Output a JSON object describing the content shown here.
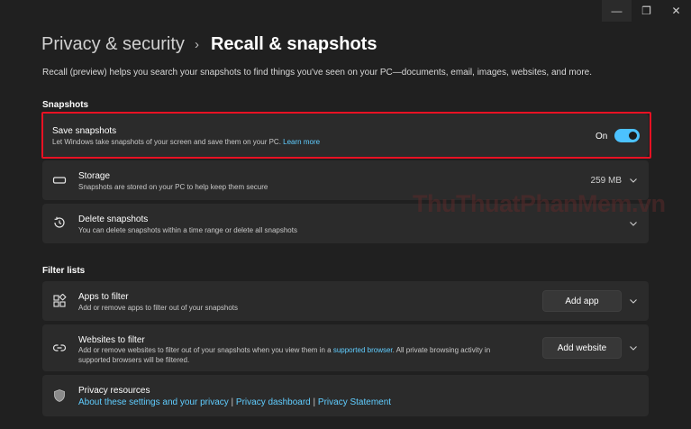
{
  "window": {
    "minimize": "—",
    "restore": "❐",
    "close": "✕"
  },
  "breadcrumb": {
    "parent": "Privacy & security",
    "separator": "›",
    "current": "Recall & snapshots"
  },
  "description": "Recall (preview) helps you search your snapshots to find things you've seen on your PC—documents, email, images, websites, and more.",
  "snapshots_section": {
    "title": "Snapshots",
    "save": {
      "title": "Save snapshots",
      "subtitle": "Let Windows take snapshots of your screen and save them on your PC.",
      "link": "Learn more",
      "toggle_label": "On",
      "toggle_state": true
    },
    "storage": {
      "icon": "storage-icon",
      "title": "Storage",
      "subtitle": "Snapshots are stored on your PC to help keep them secure",
      "value": "259 MB"
    },
    "delete": {
      "icon": "history-icon",
      "title": "Delete snapshots",
      "subtitle": "You can delete snapshots within a time range or delete all snapshots"
    }
  },
  "filter_section": {
    "title": "Filter lists",
    "apps": {
      "icon": "apps-icon",
      "title": "Apps to filter",
      "subtitle": "Add or remove apps to filter out of your snapshots",
      "button": "Add app"
    },
    "websites": {
      "icon": "link-icon",
      "title": "Websites to filter",
      "subtitle_1": "Add or remove websites to filter out of your snapshots when you view them in a",
      "link": "supported browser",
      "subtitle_2": ". All private browsing activity in",
      "subtitle_3": "supported browsers will be filtered.",
      "button": "Add website"
    },
    "privacy": {
      "icon": "shield-icon",
      "title": "Privacy resources",
      "link_1": "About these settings and your privacy",
      "sep": " | ",
      "link_2": "Privacy dashboard",
      "link_3": "Privacy Statement"
    }
  },
  "watermark": "ThuThuatPhanMem.vn",
  "colors": {
    "accent": "#4cc2ff",
    "link": "#60cdff",
    "highlight": "#e81123",
    "background": "#202020",
    "card": "#2b2b2b"
  }
}
